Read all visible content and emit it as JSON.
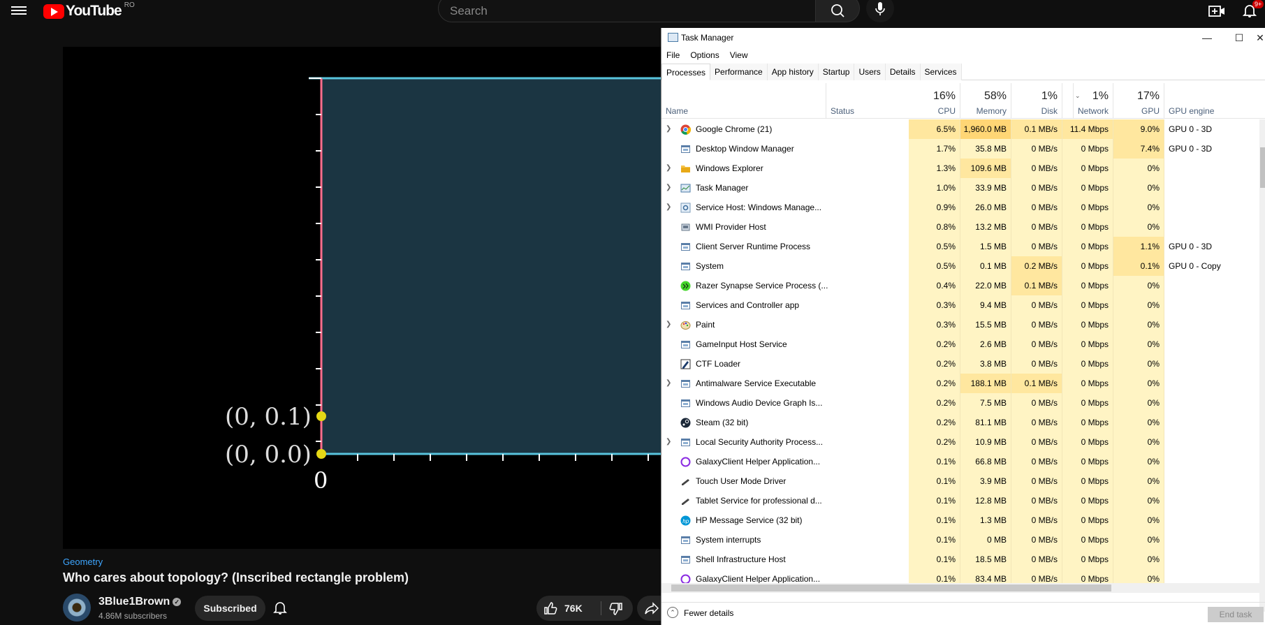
{
  "youtube": {
    "logo_text": "YouTube",
    "country_code": "RO",
    "search_placeholder": "Search",
    "notification_count": "9+",
    "category": "Geometry",
    "video_title": "Who cares about topology? (Inscribed rectangle problem)",
    "channel_name": "3Blue1Brown",
    "verified_glyph": "✓",
    "subscribers": "4.86M subscribers",
    "subscribed_label": "Subscribed",
    "like_count": "76K",
    "video_frame": {
      "labels": [
        "(0, 0.1)",
        "(0, 0.0)",
        "0"
      ],
      "colors": {
        "fill": "#1b3542",
        "edge": "#58c4dd",
        "axis": "#fc6d8b",
        "dot": "#e5d815"
      }
    }
  },
  "task_manager": {
    "title": "Task Manager",
    "menu": [
      "File",
      "Options",
      "View"
    ],
    "tabs": [
      "Processes",
      "Performance",
      "App history",
      "Startup",
      "Users",
      "Details",
      "Services"
    ],
    "active_tab": "Processes",
    "columns": {
      "name": "Name",
      "status": "Status",
      "cpu": {
        "pct": "16%",
        "label": "CPU"
      },
      "memory": {
        "pct": "58%",
        "label": "Memory"
      },
      "disk": {
        "pct": "1%",
        "label": "Disk"
      },
      "network": {
        "pct": "1%",
        "label": "Network"
      },
      "gpu": {
        "pct": "17%",
        "label": "GPU"
      },
      "gpu_engine": "GPU engine"
    },
    "processes": [
      {
        "name": "Google Chrome (21)",
        "expand": true,
        "icon": "chrome-icon",
        "cpu": "6.5%",
        "mem": "1,960.0 MB",
        "disk": "0.1 MB/s",
        "net": "11.4 Mbps",
        "gpu": "9.0%",
        "engine": "GPU 0 - 3D"
      },
      {
        "name": "Desktop Window Manager",
        "expand": false,
        "icon": "app-window-icon",
        "cpu": "1.7%",
        "mem": "35.8 MB",
        "disk": "0 MB/s",
        "net": "0 Mbps",
        "gpu": "7.4%",
        "engine": "GPU 0 - 3D"
      },
      {
        "name": "Windows Explorer",
        "expand": true,
        "icon": "folder-icon",
        "cpu": "1.3%",
        "mem": "109.6 MB",
        "disk": "0 MB/s",
        "net": "0 Mbps",
        "gpu": "0%",
        "engine": ""
      },
      {
        "name": "Task Manager",
        "expand": true,
        "icon": "task-manager-icon",
        "cpu": "1.0%",
        "mem": "33.9 MB",
        "disk": "0 MB/s",
        "net": "0 Mbps",
        "gpu": "0%",
        "engine": ""
      },
      {
        "name": "Service Host: Windows Manage...",
        "expand": true,
        "icon": "gear-icon",
        "cpu": "0.9%",
        "mem": "26.0 MB",
        "disk": "0 MB/s",
        "net": "0 Mbps",
        "gpu": "0%",
        "engine": ""
      },
      {
        "name": "WMI Provider Host",
        "expand": false,
        "icon": "wmi-icon",
        "cpu": "0.8%",
        "mem": "13.2 MB",
        "disk": "0 MB/s",
        "net": "0 Mbps",
        "gpu": "0%",
        "engine": ""
      },
      {
        "name": "Client Server Runtime Process",
        "expand": false,
        "icon": "app-window-icon",
        "cpu": "0.5%",
        "mem": "1.5 MB",
        "disk": "0 MB/s",
        "net": "0 Mbps",
        "gpu": "1.1%",
        "engine": "GPU 0 - 3D"
      },
      {
        "name": "System",
        "expand": false,
        "icon": "app-window-icon",
        "cpu": "0.5%",
        "mem": "0.1 MB",
        "disk": "0.2 MB/s",
        "net": "0 Mbps",
        "gpu": "0.1%",
        "engine": "GPU 0 - Copy"
      },
      {
        "name": "Razer Synapse Service Process (...",
        "expand": false,
        "icon": "razer-icon",
        "cpu": "0.4%",
        "mem": "22.0 MB",
        "disk": "0.1 MB/s",
        "net": "0 Mbps",
        "gpu": "0%",
        "engine": ""
      },
      {
        "name": "Services and Controller app",
        "expand": false,
        "icon": "app-window-icon",
        "cpu": "0.3%",
        "mem": "9.4 MB",
        "disk": "0 MB/s",
        "net": "0 Mbps",
        "gpu": "0%",
        "engine": ""
      },
      {
        "name": "Paint",
        "expand": true,
        "icon": "paint-icon",
        "cpu": "0.3%",
        "mem": "15.5 MB",
        "disk": "0 MB/s",
        "net": "0 Mbps",
        "gpu": "0%",
        "engine": ""
      },
      {
        "name": "GameInput Host Service",
        "expand": false,
        "icon": "app-window-icon",
        "cpu": "0.2%",
        "mem": "2.6 MB",
        "disk": "0 MB/s",
        "net": "0 Mbps",
        "gpu": "0%",
        "engine": ""
      },
      {
        "name": "CTF Loader",
        "expand": false,
        "icon": "ctf-loader-icon",
        "cpu": "0.2%",
        "mem": "3.8 MB",
        "disk": "0 MB/s",
        "net": "0 Mbps",
        "gpu": "0%",
        "engine": ""
      },
      {
        "name": "Antimalware Service Executable",
        "expand": true,
        "icon": "app-window-icon",
        "cpu": "0.2%",
        "mem": "188.1 MB",
        "disk": "0.1 MB/s",
        "net": "0 Mbps",
        "gpu": "0%",
        "engine": ""
      },
      {
        "name": "Windows Audio Device Graph Is...",
        "expand": false,
        "icon": "app-window-icon",
        "cpu": "0.2%",
        "mem": "7.5 MB",
        "disk": "0 MB/s",
        "net": "0 Mbps",
        "gpu": "0%",
        "engine": ""
      },
      {
        "name": "Steam (32 bit)",
        "expand": false,
        "icon": "steam-icon",
        "cpu": "0.2%",
        "mem": "81.1 MB",
        "disk": "0 MB/s",
        "net": "0 Mbps",
        "gpu": "0%",
        "engine": ""
      },
      {
        "name": "Local Security Authority Process...",
        "expand": true,
        "icon": "app-window-icon",
        "cpu": "0.2%",
        "mem": "10.9 MB",
        "disk": "0 MB/s",
        "net": "0 Mbps",
        "gpu": "0%",
        "engine": ""
      },
      {
        "name": "GalaxyClient Helper Application...",
        "expand": false,
        "icon": "galaxy-icon",
        "cpu": "0.1%",
        "mem": "66.8 MB",
        "disk": "0 MB/s",
        "net": "0 Mbps",
        "gpu": "0%",
        "engine": ""
      },
      {
        "name": "Touch User Mode Driver",
        "expand": false,
        "icon": "pen-icon",
        "cpu": "0.1%",
        "mem": "3.9 MB",
        "disk": "0 MB/s",
        "net": "0 Mbps",
        "gpu": "0%",
        "engine": ""
      },
      {
        "name": "Tablet Service for professional d...",
        "expand": false,
        "icon": "pen-icon",
        "cpu": "0.1%",
        "mem": "12.8 MB",
        "disk": "0 MB/s",
        "net": "0 Mbps",
        "gpu": "0%",
        "engine": ""
      },
      {
        "name": "HP Message Service (32 bit)",
        "expand": false,
        "icon": "hp-icon",
        "cpu": "0.1%",
        "mem": "1.3 MB",
        "disk": "0 MB/s",
        "net": "0 Mbps",
        "gpu": "0%",
        "engine": ""
      },
      {
        "name": "System interrupts",
        "expand": false,
        "icon": "app-window-icon",
        "cpu": "0.1%",
        "mem": "0 MB",
        "disk": "0 MB/s",
        "net": "0 Mbps",
        "gpu": "0%",
        "engine": ""
      },
      {
        "name": "Shell Infrastructure Host",
        "expand": false,
        "icon": "app-window-icon",
        "cpu": "0.1%",
        "mem": "18.5 MB",
        "disk": "0 MB/s",
        "net": "0 Mbps",
        "gpu": "0%",
        "engine": ""
      },
      {
        "name": "GalaxyClient Helper Application...",
        "expand": false,
        "icon": "galaxy-icon",
        "cpu": "0.1%",
        "mem": "83.4 MB",
        "disk": "0 MB/s",
        "net": "0 Mbps",
        "gpu": "0%",
        "engine": ""
      }
    ],
    "fewer_details": "Fewer details",
    "end_task": "End task",
    "heat_colors": {
      "light": "#fff4c4",
      "mid": "#ffe79f",
      "strong": "#ffd675"
    }
  }
}
